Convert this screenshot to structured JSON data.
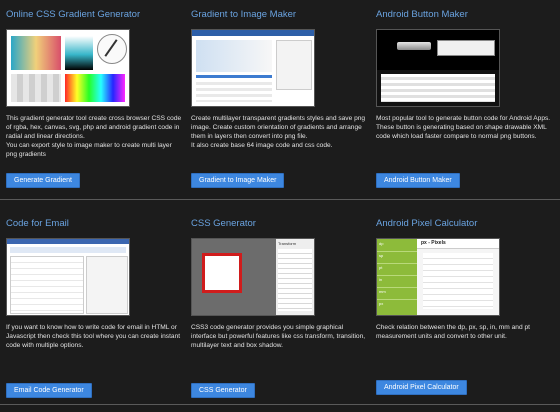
{
  "cards": [
    {
      "title": "Online CSS Gradient Generator",
      "description": "This gradient generator tool create cross browser CSS code of rgba, hex, canvas, svg, php and android gradient code in radial and linear directions.\nYou can export style to image maker to create multi layer png gradients",
      "button": "Generate Gradient"
    },
    {
      "title": "Gradient to Image Maker",
      "description": "Create multilayer transparent gradients styles and save png image. Create custom orientation of gradients and arrange them in layers then convert into png file.\nIt also create base 64 image code and css code.",
      "button": "Gradient to Image Maker"
    },
    {
      "title": "Android Button Maker",
      "description": "Most popular tool to generate button code for Android Apps. These button is generating based on shape drawable XML code which load faster compare to normal png buttons.",
      "button": "Android Button Maker"
    },
    {
      "title": "Code for Email",
      "description": "If you want to know how to write code for email in HTML or Javascript then check this tool where you can create instant code with multiple options.",
      "button": "Email Code Generator"
    },
    {
      "title": "CSS Generator",
      "description": "CSS3 code generator provides you simple graphical interface but powerful features like css transform, transition, multilayer text and box shadow.",
      "button": "CSS Generator"
    },
    {
      "title": "Android Pixel Calculator",
      "description": "Check relation between the dp, px, sp, in, mm and pt measurement units and convert to other unit.",
      "button": "Android Pixel Calculator"
    }
  ],
  "thumb_text": {
    "pixel_header": "px - Pixels",
    "pixel_cells": [
      "dp",
      "sp",
      "pt",
      "in",
      "mm",
      "px"
    ],
    "css_panel": "Transform"
  },
  "colors": {
    "title": "#6aa3e0",
    "button": "#3d87e0",
    "background": "#1c1c1c",
    "pixel_green": "#8dbb3a"
  }
}
